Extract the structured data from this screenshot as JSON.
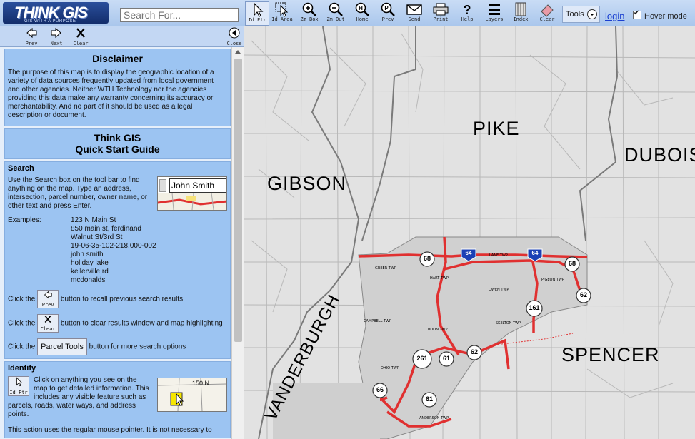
{
  "logo": {
    "text": "THINK GIS",
    "tagline": "GIS WITH A PURPOSE"
  },
  "search": {
    "placeholder": "Search For..."
  },
  "toolbar": {
    "buttons": [
      {
        "label": "Id Ftr",
        "icon": "pointer-icon"
      },
      {
        "label": "Id Area",
        "icon": "area-pointer-icon"
      },
      {
        "label": "Zm Box",
        "icon": "zoom-in-icon"
      },
      {
        "label": "Zm Out",
        "icon": "zoom-out-icon"
      },
      {
        "label": "Home",
        "icon": "home-icon"
      },
      {
        "label": "Prev",
        "icon": "prev-view-icon"
      },
      {
        "label": "Send",
        "icon": "envelope-icon"
      },
      {
        "label": "Print",
        "icon": "printer-icon"
      },
      {
        "label": "Help",
        "icon": "help-icon"
      },
      {
        "label": "Layers",
        "icon": "layers-icon"
      },
      {
        "label": "Index",
        "icon": "index-icon"
      },
      {
        "label": "Clear",
        "icon": "eraser-icon"
      }
    ],
    "tools_label": "Tools",
    "login_label": "login",
    "hover_mode_label": "Hover mode",
    "hover_mode_checked": true
  },
  "nav": {
    "prev": "Prev",
    "next": "Next",
    "clear": "Clear",
    "close": "Close"
  },
  "disclaimer": {
    "title": "Disclaimer",
    "text": "The purpose of this map is to display the geographic location of a variety of data sources frequently updated from local government and other agencies. Neither WTH Technology nor the agencies providing this data make any warranty concerning its accuracy or merchantability. And no part of it should be used as a legal description or document."
  },
  "guide": {
    "title_line1": "Think GIS",
    "title_line2": "Quick Start Guide"
  },
  "search_section": {
    "heading": "Search",
    "text": "Use the Search box on the tool bar to find anything on the map. Type an address, intersection, parcel number, owner name, or other text and press Enter.",
    "sample_value": "John Smith",
    "examples_label": "Examples:",
    "examples": [
      "123 N Main St",
      "850 main st, ferdinand",
      "Walnut St/3rd St",
      "19-06-35-102-218.000-002",
      "john smith",
      "holiday lake",
      "kellerville rd",
      "mcdonalds"
    ],
    "click_prefix": "Click the",
    "prev_btn": "Prev",
    "prev_text": "button to recall previous search results",
    "clear_btn": "Clear",
    "clear_text": "button to clear results window and map highlighting",
    "parcel_btn": "Parcel Tools",
    "parcel_text": "button for more search options"
  },
  "identify_section": {
    "heading": "Identify",
    "btn": "Id Ftr",
    "text": "Click on anything you see on the map to get detailed information. This includes any visible feature such as parcels, roads, water ways, and address points.",
    "thumb_label": "150 N",
    "more": "This action uses the regular mouse pointer. It is not necessary to"
  },
  "map": {
    "counties": [
      "PIKE",
      "DUBOIS",
      "GIBSON",
      "VANDERBURGH",
      "SPENCER"
    ],
    "interstates": [
      "64",
      "64"
    ],
    "routes": [
      "68",
      "68",
      "62",
      "161",
      "261",
      "61",
      "62",
      "66",
      "61"
    ],
    "townships": [
      "GREER TWP",
      "LANE TWP",
      "HART TWP",
      "PIGEON TWP",
      "OWEN TWP",
      "CAMPBELL TWP",
      "SKELTON TWP",
      "BOON TWP",
      "OHIO TWP",
      "ANDERSON TWP"
    ]
  },
  "colors": {
    "panel_blue": "#9cc4f2",
    "highway_red": "#e03030",
    "map_gray": "#e2e2e2"
  }
}
